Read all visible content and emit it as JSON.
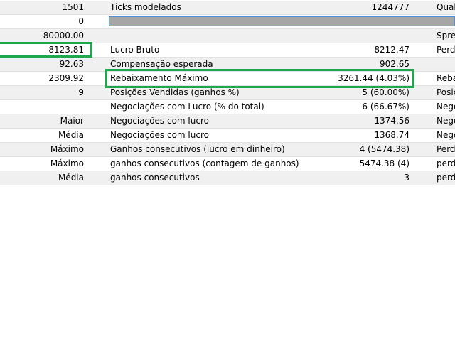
{
  "highlight_color": "#1ea84b",
  "progress": {
    "value_fraction": 1.0
  },
  "rows": [
    {
      "c1": "1501",
      "c2": "Ticks modelados",
      "c3": "1244777",
      "c4": "Qualidade"
    },
    {
      "c1": "0",
      "c2": "",
      "c3": "",
      "c4": ""
    },
    {
      "c1": "80000.00",
      "c2": "",
      "c3": "",
      "c4": "Spread"
    },
    {
      "c1": "8123.81",
      "c2": "Lucro Bruto",
      "c3": "8212.47",
      "c4": "Perda"
    },
    {
      "c1": "92.63",
      "c2": "Compensação esperada",
      "c3": "902.65",
      "c4": ""
    },
    {
      "c1": "2309.92",
      "c2": "Rebaixamento Máximo",
      "c3": "3261.44 (4.03%)",
      "c4": "Rebaixamento"
    },
    {
      "c1": "9",
      "c2": "Posições Vendidas (ganhos %)",
      "c3": "5 (60.00%)",
      "c4": "Posições"
    },
    {
      "c1": "",
      "c2": "Negociações com Lucro (% do total)",
      "c3": "6 (66.67%)",
      "c4": "Negociações"
    },
    {
      "c1": "Maior",
      "c2": "Negociações com lucro",
      "c3": "1374.56",
      "c4": "Negociações"
    },
    {
      "c1": "Média",
      "c2": "Negociações com lucro",
      "c3": "1368.74",
      "c4": "Negociações"
    },
    {
      "c1": "Máximo",
      "c2": "Ganhos consecutivos (lucro em dinheiro)",
      "c3": "4 (5474.38)",
      "c4": "Perdas"
    },
    {
      "c1": "Máximo",
      "c2": "ganhos consecutivos (contagem de ganhos)",
      "c3": "5474.38 (4)",
      "c4": "perdas"
    },
    {
      "c1": "Média",
      "c2": "ganhos consecutivos",
      "c3": "3",
      "c4": "perdas"
    }
  ]
}
